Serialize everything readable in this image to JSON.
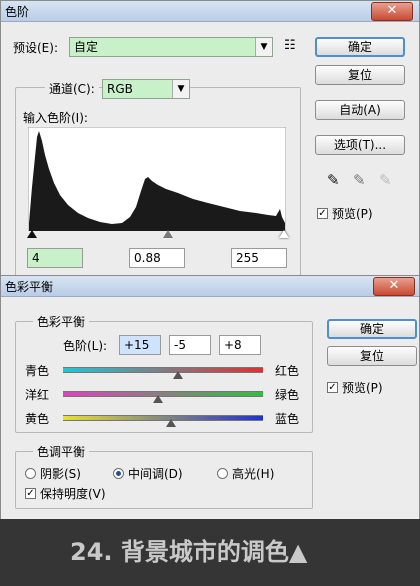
{
  "levels": {
    "title": "色阶",
    "close_glyph": "✕",
    "preset_label": "预设(E):",
    "preset_value": "自定",
    "channel_label": "通道(C):",
    "channel_value": "RGB",
    "input_levels_label": "输入色阶(I):",
    "input_black": "4",
    "input_gamma": "0.88",
    "input_white": "255",
    "buttons": {
      "ok": "确定",
      "reset": "复位",
      "auto": "自动(A)",
      "options": "选项(T)..."
    },
    "preview_label": "预览(P)",
    "preview_checked": true
  },
  "color_balance": {
    "title": "色彩平衡",
    "close_glyph": "✕",
    "group_label": "色彩平衡",
    "levels_label": "色阶(L):",
    "values": [
      "+15",
      "-5",
      "+8"
    ],
    "sliders": [
      {
        "left": "青色",
        "right": "红色",
        "value": 15
      },
      {
        "left": "洋红",
        "right": "绿色",
        "value": -5
      },
      {
        "left": "黄色",
        "right": "蓝色",
        "value": 8
      }
    ],
    "tone_group_label": "色调平衡",
    "tones": {
      "shadows": "阴影(S)",
      "midtones": "中间调(D)",
      "highlights": "高光(H)"
    },
    "tone_selected": "midtones",
    "preserve_label": "保持明度(V)",
    "preserve_checked": true,
    "buttons": {
      "ok": "确定",
      "reset": "复位"
    },
    "preview_label": "预览(P)",
    "preview_checked": true
  },
  "caption": "24. 背景城市的调色▲",
  "colors": {
    "select_bg": "#c9f1c9",
    "default_border": "#4d8fd0",
    "histogram": "#1a1a1a"
  }
}
